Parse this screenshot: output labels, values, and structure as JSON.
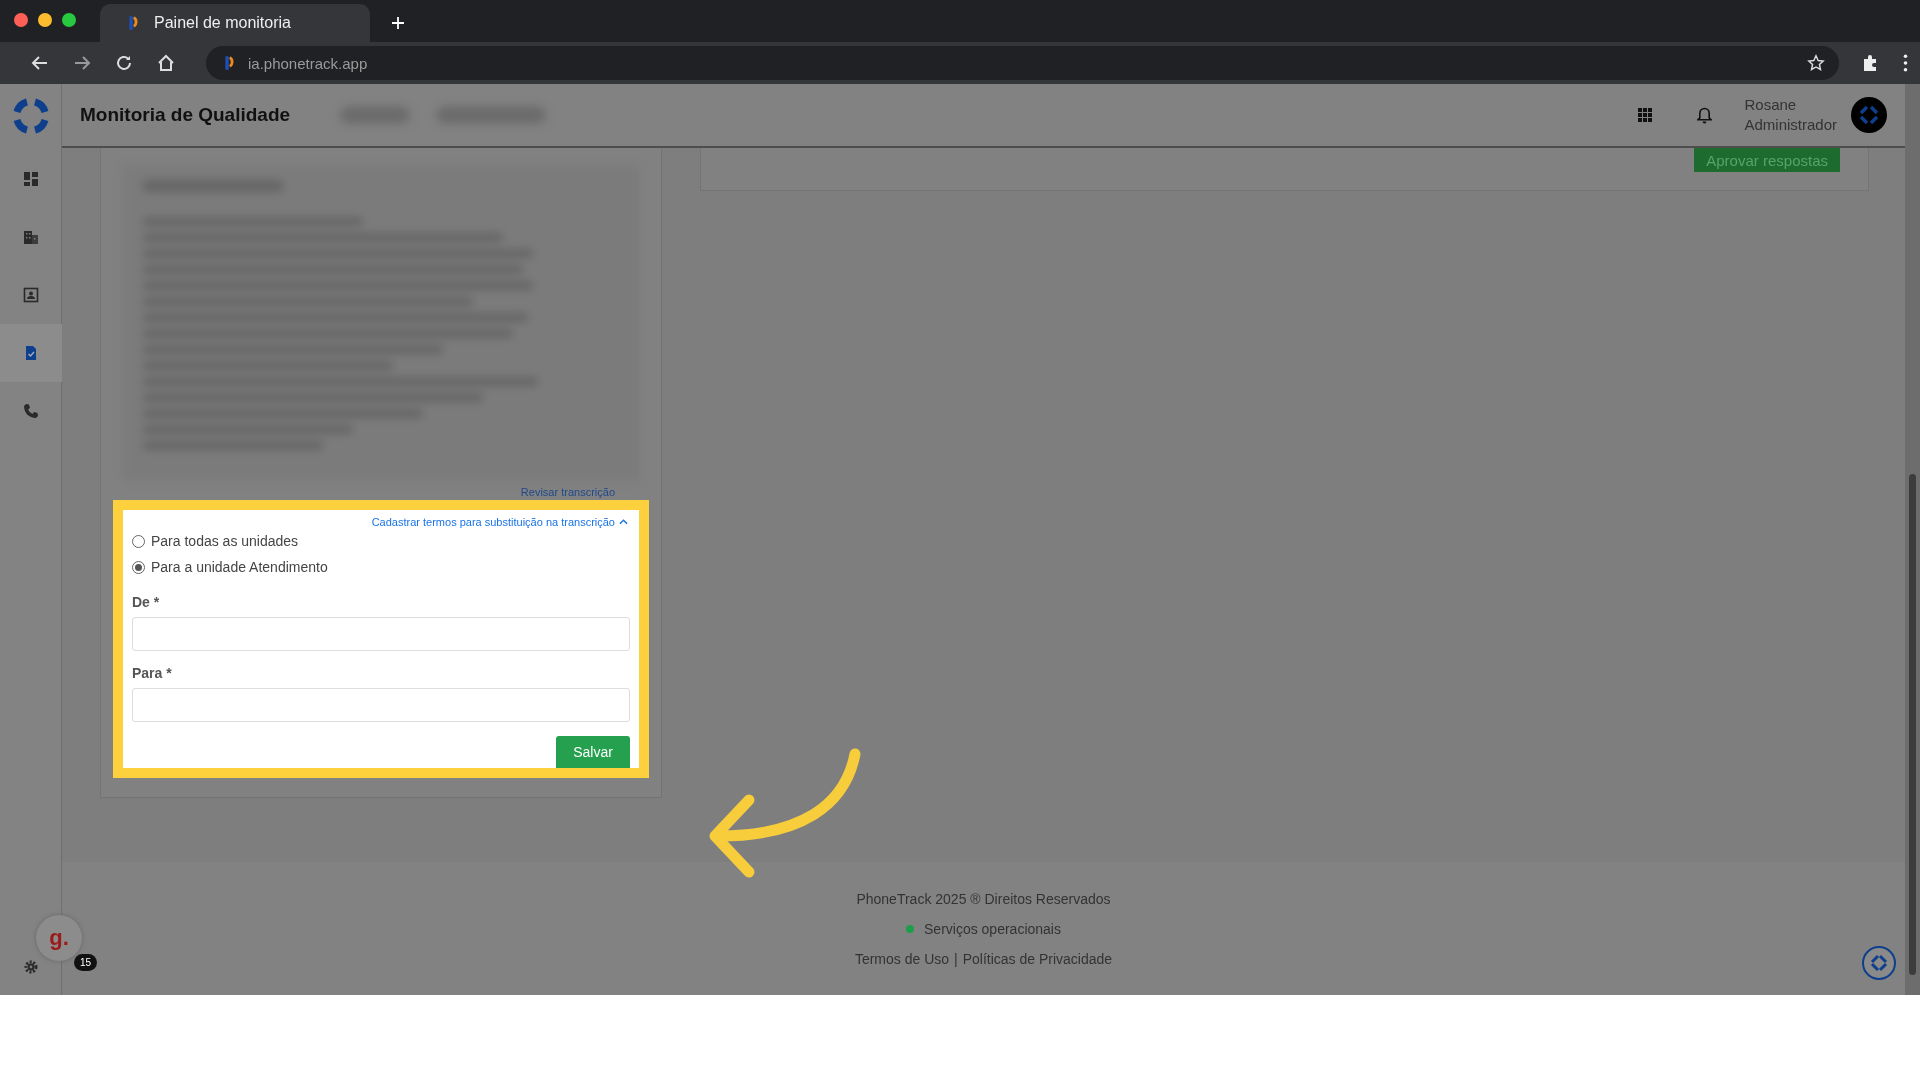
{
  "browser": {
    "tab_title": "Painel de monitoria",
    "url": "ia.phonetrack.app"
  },
  "header": {
    "title": "Monitoria de Qualidade",
    "user": {
      "name": "Rosane",
      "role": "Administrador"
    }
  },
  "sidebar": {
    "items": [
      {
        "kind": "dashboard",
        "selected": false
      },
      {
        "kind": "building",
        "selected": false
      },
      {
        "kind": "contact",
        "selected": false
      },
      {
        "kind": "document",
        "selected": true
      },
      {
        "kind": "phone",
        "selected": false
      }
    ]
  },
  "approve_button": "Aprovar respostas",
  "review_link": "Revisar transcrição",
  "form": {
    "toggle_link": "Cadastrar termos para substituição na transcrição",
    "expanded": true,
    "options": [
      {
        "label": "Para todas as unidades",
        "selected": false
      },
      {
        "label": "Para a unidade Atendimento",
        "selected": true
      }
    ],
    "fields": [
      {
        "label": "De *"
      },
      {
        "label": "Para *"
      }
    ],
    "button": "Salvar"
  },
  "footer": {
    "copyright": "PhoneTrack 2025 ® Direitos Reservados",
    "status": {
      "text": "Serviços operacionais",
      "color": "#1e9e4a"
    },
    "links": [
      "Termos de Uso",
      "Políticas de Privacidade"
    ],
    "separator": "|"
  },
  "chat_widget": {
    "avatar": "g.",
    "badge": "15"
  }
}
